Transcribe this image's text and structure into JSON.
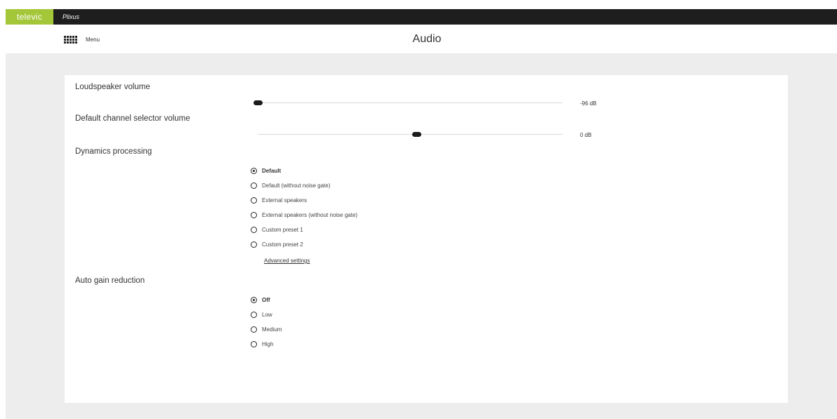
{
  "topbar": {
    "brand": "televic",
    "product": "Plixus"
  },
  "header": {
    "menu_label": "Menu",
    "title": "Audio"
  },
  "sections": {
    "loudspeaker": {
      "title": "Loudspeaker volume",
      "value_label": "-96 dB",
      "level": 0.0
    },
    "channel_selector": {
      "title": "Default channel selector volume",
      "value_label": "0 dB",
      "level": 0.52
    },
    "dynamics": {
      "title": "Dynamics processing",
      "options": [
        {
          "label": "Default",
          "checked": true
        },
        {
          "label": "Default (without noise gate)",
          "checked": false
        },
        {
          "label": "External speakers",
          "checked": false
        },
        {
          "label": "External speakers (without noise gate)",
          "checked": false
        },
        {
          "label": "Custom preset 1",
          "checked": false
        },
        {
          "label": "Custom preset 2",
          "checked": false
        }
      ],
      "advanced_link": "Advanced settings"
    },
    "agr": {
      "title": "Auto gain reduction",
      "options": [
        {
          "label": "Off",
          "checked": true
        },
        {
          "label": "Low",
          "checked": false
        },
        {
          "label": "Medium",
          "checked": false
        },
        {
          "label": "High",
          "checked": false
        }
      ]
    }
  },
  "colors": {
    "brand": "#a4c639",
    "topbar": "#1e1e1e",
    "canvas": "#ededed"
  }
}
